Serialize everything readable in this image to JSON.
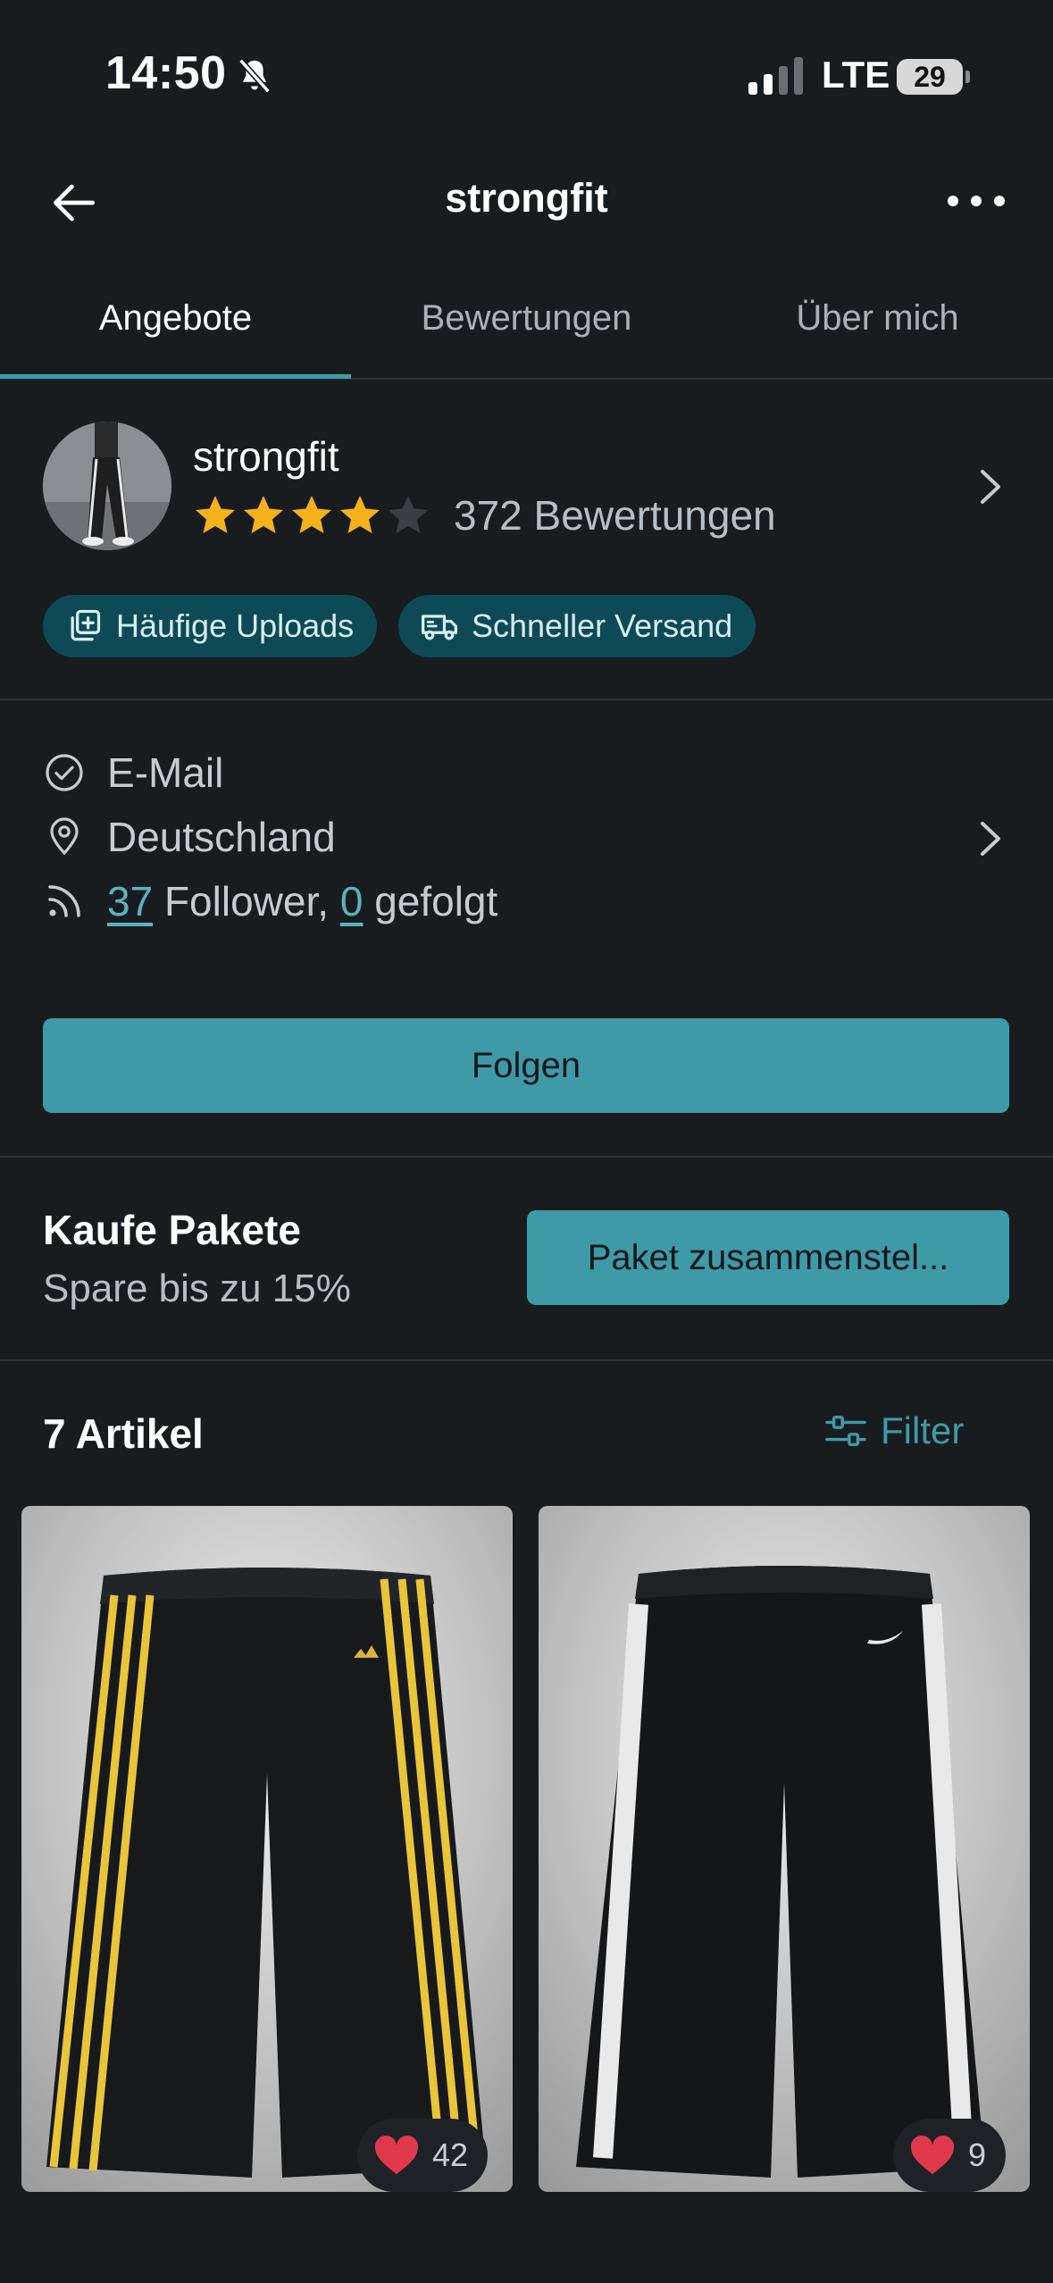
{
  "status_bar": {
    "time": "14:50",
    "network": "LTE",
    "battery": "29"
  },
  "nav": {
    "title": "strongfit"
  },
  "tabs": [
    {
      "label": "Angebote",
      "active": true
    },
    {
      "label": "Bewertungen",
      "active": false
    },
    {
      "label": "Über mich",
      "active": false
    }
  ],
  "profile": {
    "name": "strongfit",
    "rating": 4.5,
    "reviews": "372 Bewertungen",
    "badges": [
      "Häufige Uploads",
      "Schneller Versand"
    ]
  },
  "info": {
    "email": "E-Mail",
    "location": "Deutschland",
    "followers_count": "37",
    "followers_label": "Follower,",
    "following_count": "0",
    "following_label": "gefolgt"
  },
  "actions": {
    "follow": "Folgen"
  },
  "bundle": {
    "title": "Kaufe Pakete",
    "subtitle": "Spare bis zu 15%",
    "button": "Paket zusammenstel..."
  },
  "listing": {
    "count": "7 Artikel",
    "filter": "Filter"
  },
  "items": [
    {
      "likes": "42",
      "stripe_color": "#e9c53a"
    },
    {
      "likes": "9",
      "stripe_color": "#e9e9ea"
    }
  ],
  "colors": {
    "accent": "#3f9aa7",
    "badge_bg": "#0d4a56",
    "background": "#181c1f",
    "star": "#f6b21b",
    "heart": "#e0394e"
  }
}
